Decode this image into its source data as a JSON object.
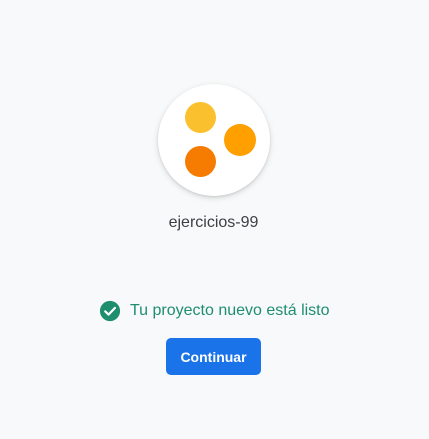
{
  "project": {
    "name": "ejercicios-99",
    "logo_colors": [
      "#fbc02d",
      "#ffa000",
      "#f57c00"
    ]
  },
  "status": {
    "text": "Tu proyecto nuevo está listo",
    "icon": "check-circle-icon",
    "color": "#1e8e6e"
  },
  "actions": {
    "continue_label": "Continuar",
    "accent_color": "#1a73e8"
  }
}
